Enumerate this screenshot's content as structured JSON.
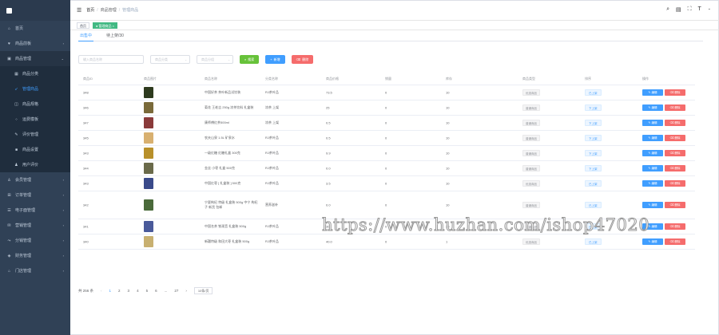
{
  "sidebar": {
    "logo_text": "",
    "items": [
      {
        "label": "首页",
        "icon": "home-icon",
        "sub": false
      },
      {
        "label": "商品前板",
        "icon": "shield-icon",
        "sub": false,
        "arrow": "›"
      },
      {
        "label": "商品管理",
        "icon": "box-icon",
        "sub": false,
        "arrow": "⌄"
      },
      {
        "label": "商品分类",
        "icon": "grid-icon",
        "sub": true
      },
      {
        "label": "管理商品",
        "icon": "send-icon",
        "sub": true,
        "active": true
      },
      {
        "label": "商品规格",
        "icon": "cube-icon",
        "sub": true
      },
      {
        "label": "运费模板",
        "icon": "dots-icon",
        "sub": true
      },
      {
        "label": "评价管理",
        "icon": "edit-icon",
        "sub": true
      },
      {
        "label": "商品设置",
        "icon": "square-icon",
        "sub": true
      },
      {
        "label": "用户评价",
        "icon": "user-icon",
        "sub": true
      },
      {
        "label": "会员管理",
        "icon": "person-icon",
        "sub": false,
        "arrow": "›"
      },
      {
        "label": "订单管理",
        "icon": "cart-icon",
        "sub": false,
        "arrow": "›"
      },
      {
        "label": "电子面管理",
        "icon": "list-icon",
        "sub": false,
        "arrow": "›"
      },
      {
        "label": "营销管理",
        "icon": "gift-icon",
        "sub": false,
        "arrow": "›"
      },
      {
        "label": "分销管理",
        "icon": "share-icon",
        "sub": false,
        "arrow": "›"
      },
      {
        "label": "财务管理",
        "icon": "wallet-icon",
        "sub": false,
        "arrow": "›"
      },
      {
        "label": "门店管理",
        "icon": "store-icon",
        "sub": false,
        "arrow": "›"
      }
    ]
  },
  "topbar": {
    "crumb1": "首页",
    "crumb2": "商品管理",
    "crumb3": "管理商品"
  },
  "tags": {
    "home": "首页",
    "active": "管理商品 ×"
  },
  "tabs": [
    "出售中",
    "待上架/30"
  ],
  "filters": {
    "search_placeholder": "输入商品名称",
    "select1_placeholder": "商品分类",
    "select2_placeholder": "商品分组",
    "search_btn": "搜索",
    "add_btn": "新增",
    "delete_btn": "删除"
  },
  "table": {
    "headers": [
      "商品ID",
      "商品图片",
      "商品名称",
      "分类名称",
      "商品价格",
      "销量",
      "库存",
      "商品类型",
      "排序",
      "操作"
    ],
    "rows": [
      {
        "id": "348",
        "name": "中国好茶 茶叶新品试饮装",
        "category": "RJ茶叶品",
        "price": "73.5",
        "sales": "0",
        "stock": "10",
        "type": "优选商品",
        "sort": "已上架",
        "img": "#2d3a1e"
      },
      {
        "id": "346",
        "name": "菊花 王老吉 250g 凉茶饮料 礼盒装",
        "category": "凉茶 上架",
        "price": "25",
        "sales": "0",
        "stock": "10",
        "type": "普通商品",
        "sort": "下上架",
        "img": "#7a6a3a"
      },
      {
        "id": "347",
        "name": "康师傅红茶500ml",
        "category": "凉茶 上架",
        "price": "0.5",
        "sales": "0",
        "stock": "10",
        "type": "普通商品",
        "sort": "下上架",
        "img": "#8a3a3a"
      },
      {
        "id": "345",
        "name": "农夫山泉 1.5L 矿泉水",
        "category": "RJ茶叶品",
        "price": "0.5",
        "sales": "0",
        "stock": "10",
        "type": "普通商品",
        "sort": "下上架",
        "img": "#d8b070"
      },
      {
        "id": "343",
        "name": "一级红糖 红糖礼盒 300克",
        "category": "RJ茶叶品",
        "price": "9.9",
        "sales": "0",
        "stock": "10",
        "type": "普通商品",
        "sort": "下上架",
        "img": "#b8902a"
      },
      {
        "id": "344",
        "name": "金丝 小枣 礼盒 500克",
        "category": "RJ茶叶品",
        "price": "0.0",
        "sales": "0",
        "stock": "10",
        "type": "普通商品",
        "sort": "下上架",
        "img": "#6a6a4a"
      },
      {
        "id": "343",
        "name": "中国红枣 [ 礼盒装 ] 500克",
        "category": "RJ茶叶品",
        "price": "3.5",
        "sales": "0",
        "stock": "10",
        "type": "优选商品",
        "sort": "已上架",
        "img": "#3a4a8a"
      },
      {
        "id": "342",
        "name": "宁夏枸杞 特级 礼盒装 500g 中宁 枸杞子 新货 包邮",
        "category": "营养滋补",
        "price": "0.0",
        "sales": "0",
        "stock": "10",
        "type": "普通商品",
        "sort": "已上架",
        "img": "#4a6a3a"
      },
      {
        "id": "341",
        "name": "中国名茶 铁观音 礼盒装 500g",
        "category": "RJ茶叶品",
        "price": "30",
        "sales": "0",
        "stock": "30",
        "type": "普通商品",
        "sort": "已上架",
        "img": "#4a5a9a"
      },
      {
        "id": "340",
        "name": "新疆特级 和田大枣 礼盒装 500g",
        "category": "RJ茶叶品",
        "price": "40.0",
        "sales": "0",
        "stock": "1",
        "type": "优选商品",
        "sort": "已上架",
        "img": "#c8b070"
      }
    ],
    "edit_label": "编辑",
    "del_label": "删除"
  },
  "pager": {
    "total": "共 256 条",
    "prev": "‹",
    "pages": [
      "1",
      "2",
      "3",
      "4",
      "5",
      "6",
      "...",
      "27"
    ],
    "next": "›",
    "size": "10条/页"
  },
  "watermark": "https://www.huzhan.com/ishop47020",
  "colors": {
    "sidebar": "#304156",
    "accent": "#409eff",
    "success": "#67c23a",
    "danger": "#f56c6c"
  }
}
